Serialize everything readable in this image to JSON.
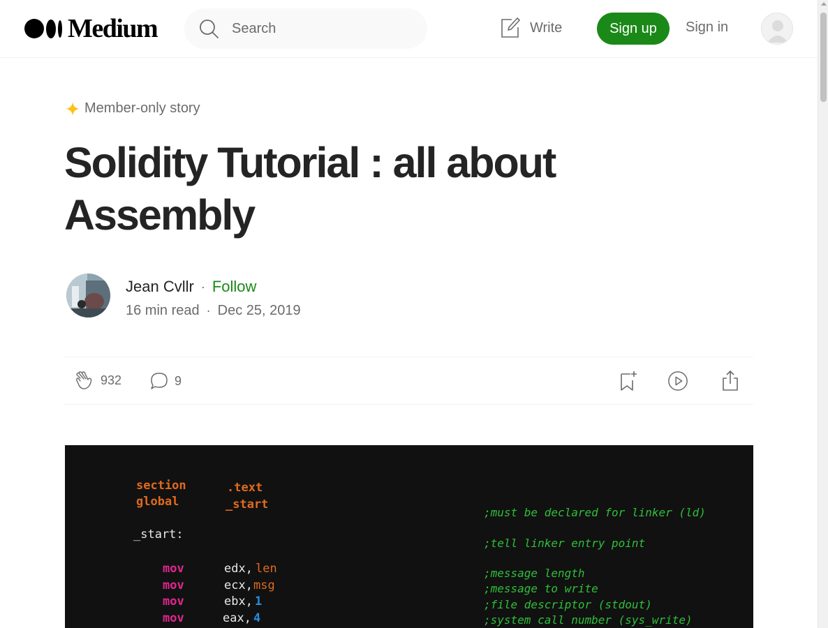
{
  "header": {
    "logo_text": "Medium",
    "search_placeholder": "Search",
    "write_label": "Write",
    "signup_label": "Sign up",
    "signin_label": "Sign in"
  },
  "article": {
    "member_badge": "Member-only story",
    "title": "Solidity Tutorial : all about Assembly",
    "author": "Jean Cvllr",
    "separator": "·",
    "follow_label": "Follow",
    "read_time": "16 min read",
    "date": "Dec 25, 2019",
    "claps": "932",
    "responses": "9"
  },
  "code_image": {
    "lines": [
      {
        "kw": "section",
        "arg": ".text",
        "comment": ""
      },
      {
        "kw": "global",
        "arg": "_start",
        "comment": ";must be declared for linker (ld)"
      },
      {
        "label": "_start:",
        "comment": ";tell linker entry point"
      },
      {
        "op": "mov",
        "reg": "edx,",
        "val": "len",
        "comment": ";message length"
      },
      {
        "op": "mov",
        "reg": "ecx,",
        "val": "msg",
        "comment": ";message to write"
      },
      {
        "op": "mov",
        "reg": "ebx,",
        "val": "1",
        "comment": ";file descriptor (stdout)"
      },
      {
        "op": "mov",
        "reg": "eax,",
        "val": "4",
        "comment": ";system call number (sys_write)"
      }
    ]
  },
  "colors": {
    "brand_green": "#1a8917",
    "text_primary": "#242424",
    "text_secondary": "#6b6b6b",
    "member_star": "#ffc017"
  },
  "icons": {
    "search": "search-icon",
    "write": "write-icon",
    "clap": "clap-icon",
    "response": "response-icon",
    "bookmark": "bookmark-icon",
    "listen": "play-icon",
    "share": "share-icon",
    "member": "star-icon"
  }
}
